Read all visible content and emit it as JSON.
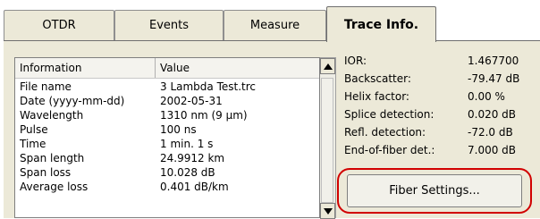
{
  "tabs": [
    {
      "label": "OTDR"
    },
    {
      "label": "Events"
    },
    {
      "label": "Measure"
    },
    {
      "label": "Trace Info."
    }
  ],
  "info_table": {
    "headers": [
      "Information",
      "Value"
    ],
    "rows": [
      [
        "File name",
        "3 Lambda Test.trc"
      ],
      [
        "Date (yyyy-mm-dd)",
        "2002-05-31"
      ],
      [
        "Wavelength",
        "1310 nm (9 µm)"
      ],
      [
        "Pulse",
        "100 ns"
      ],
      [
        "Time",
        "1 min. 1 s"
      ],
      [
        "Span length",
        "24.9912 km"
      ],
      [
        "Span loss",
        "10.028 dB"
      ],
      [
        "Average loss",
        "0.401 dB/km"
      ]
    ]
  },
  "scrollbar": {
    "up_icon": "arrow-up-icon",
    "down_icon": "arrow-down-icon"
  },
  "properties": [
    {
      "label": "IOR:",
      "value": "1.467700"
    },
    {
      "label": "Backscatter:",
      "value": "-79.47 dB"
    },
    {
      "label": "Helix factor:",
      "value": "0.00 %"
    },
    {
      "label": "Splice detection:",
      "value": "0.020 dB"
    },
    {
      "label": "Refl. detection:",
      "value": "-72.0 dB"
    },
    {
      "label": "End-of-fiber det.:",
      "value": "7.000 dB"
    }
  ],
  "fiber_settings_button": {
    "label": "Fiber Settings..."
  },
  "colors": {
    "highlight": "#d10000",
    "panel": "#ece9d8"
  }
}
